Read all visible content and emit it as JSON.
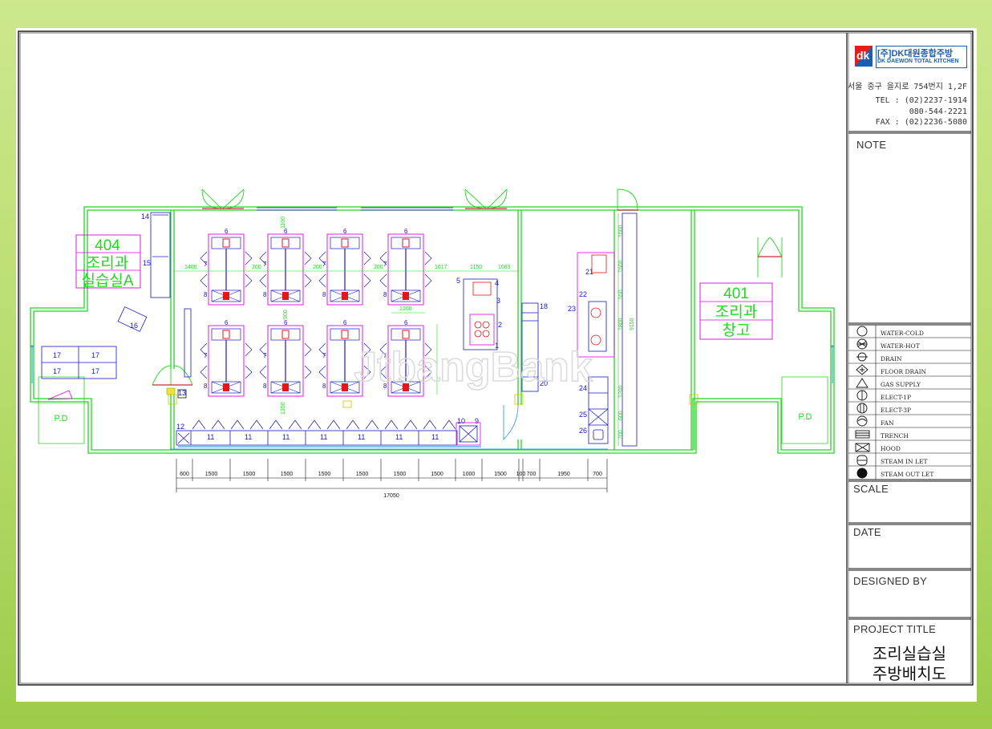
{
  "title_block": {
    "company_badge": "dk",
    "company_name": "[주]DK대원종합주방",
    "company_sub": "DK DAEWON TOTAL KITCHEN",
    "address": "서울 중구 을지로 754번지 1,2F",
    "tel": "TEL : (02)2237-1914",
    "tel2": "080-544-2221",
    "fax": "FAX : (02)2236-5080",
    "note_label": "NOTE",
    "scale_label": "SCALE",
    "date_label": "DATE",
    "designed_label": "DESIGNED BY",
    "project_label": "PROJECT TITLE",
    "project_line1": "조리실습실",
    "project_line2": "주방배치도"
  },
  "legend": [
    {
      "icon": "water-cold-icon",
      "label": "WATER-COLD"
    },
    {
      "icon": "water-hot-icon",
      "label": "WATER-HOT"
    },
    {
      "icon": "drain-icon",
      "label": "DRAIN"
    },
    {
      "icon": "floor-drain-icon",
      "label": "FLOOR DRAIN"
    },
    {
      "icon": "gas-supply-icon",
      "label": "GAS SUPPLY"
    },
    {
      "icon": "elect-1p-icon",
      "label": "ELECT-1P"
    },
    {
      "icon": "elect-3p-icon",
      "label": "ELECT-3P"
    },
    {
      "icon": "fan-icon",
      "label": "FAN"
    },
    {
      "icon": "trench-icon",
      "label": "TRENCH"
    },
    {
      "icon": "hood-icon",
      "label": "HOOD"
    },
    {
      "icon": "steam-inlet-icon",
      "label": "STEAM IN LET"
    },
    {
      "icon": "steam-outlet-icon",
      "label": "STEAM OUT LET"
    }
  ],
  "rooms": {
    "left_no": "404",
    "left_name1": "조리과",
    "left_name2": "실습실A",
    "right_no": "401",
    "right_name1": "조리과",
    "right_name2": "창고",
    "pd_left": "P.D",
    "pd_right": "P.D"
  },
  "bottom_dims": [
    "600",
    "1500",
    "1500",
    "1500",
    "1500",
    "1500",
    "1500",
    "1500",
    "1000",
    "1500",
    "100",
    "700",
    "1950",
    "700"
  ],
  "total_dim": "17050",
  "plan_dims": {
    "d1400": "1400",
    "d200a": "200",
    "d200b": "200",
    "d200c": "200",
    "d1617": "1617",
    "d1150": "1150",
    "d1083": "1083",
    "d1100": "1100",
    "d900": "900",
    "d1200": "1200",
    "d1350": "1350",
    "v1600": "1600",
    "v1500": "1500",
    "v550": "550",
    "v1800": "1800",
    "v9150": "9150",
    "v1200": "1200",
    "v600": "600",
    "v700": "700"
  },
  "item_numbers": {
    "n1": "1",
    "n2": "2",
    "n3": "3",
    "n4": "4",
    "n5": "5",
    "n6": "6",
    "n7": "7",
    "n8": "8",
    "n9": "9",
    "n10": "10",
    "n11": "11",
    "n12": "12",
    "n13": "13",
    "n14": "14",
    "n15": "15",
    "n16": "16",
    "n17": "17",
    "n18": "18",
    "n20": "20",
    "n21": "21",
    "n22": "22",
    "n23": "23",
    "n24": "24",
    "n25": "25",
    "n26": "26"
  },
  "watermark": "JtbangBank",
  "colors": {
    "wall": "#1fd81f",
    "equipment": "#1818c8",
    "magenta": "#e000e0",
    "red": "#e01818",
    "border": "#111111",
    "door": "#b00000"
  }
}
